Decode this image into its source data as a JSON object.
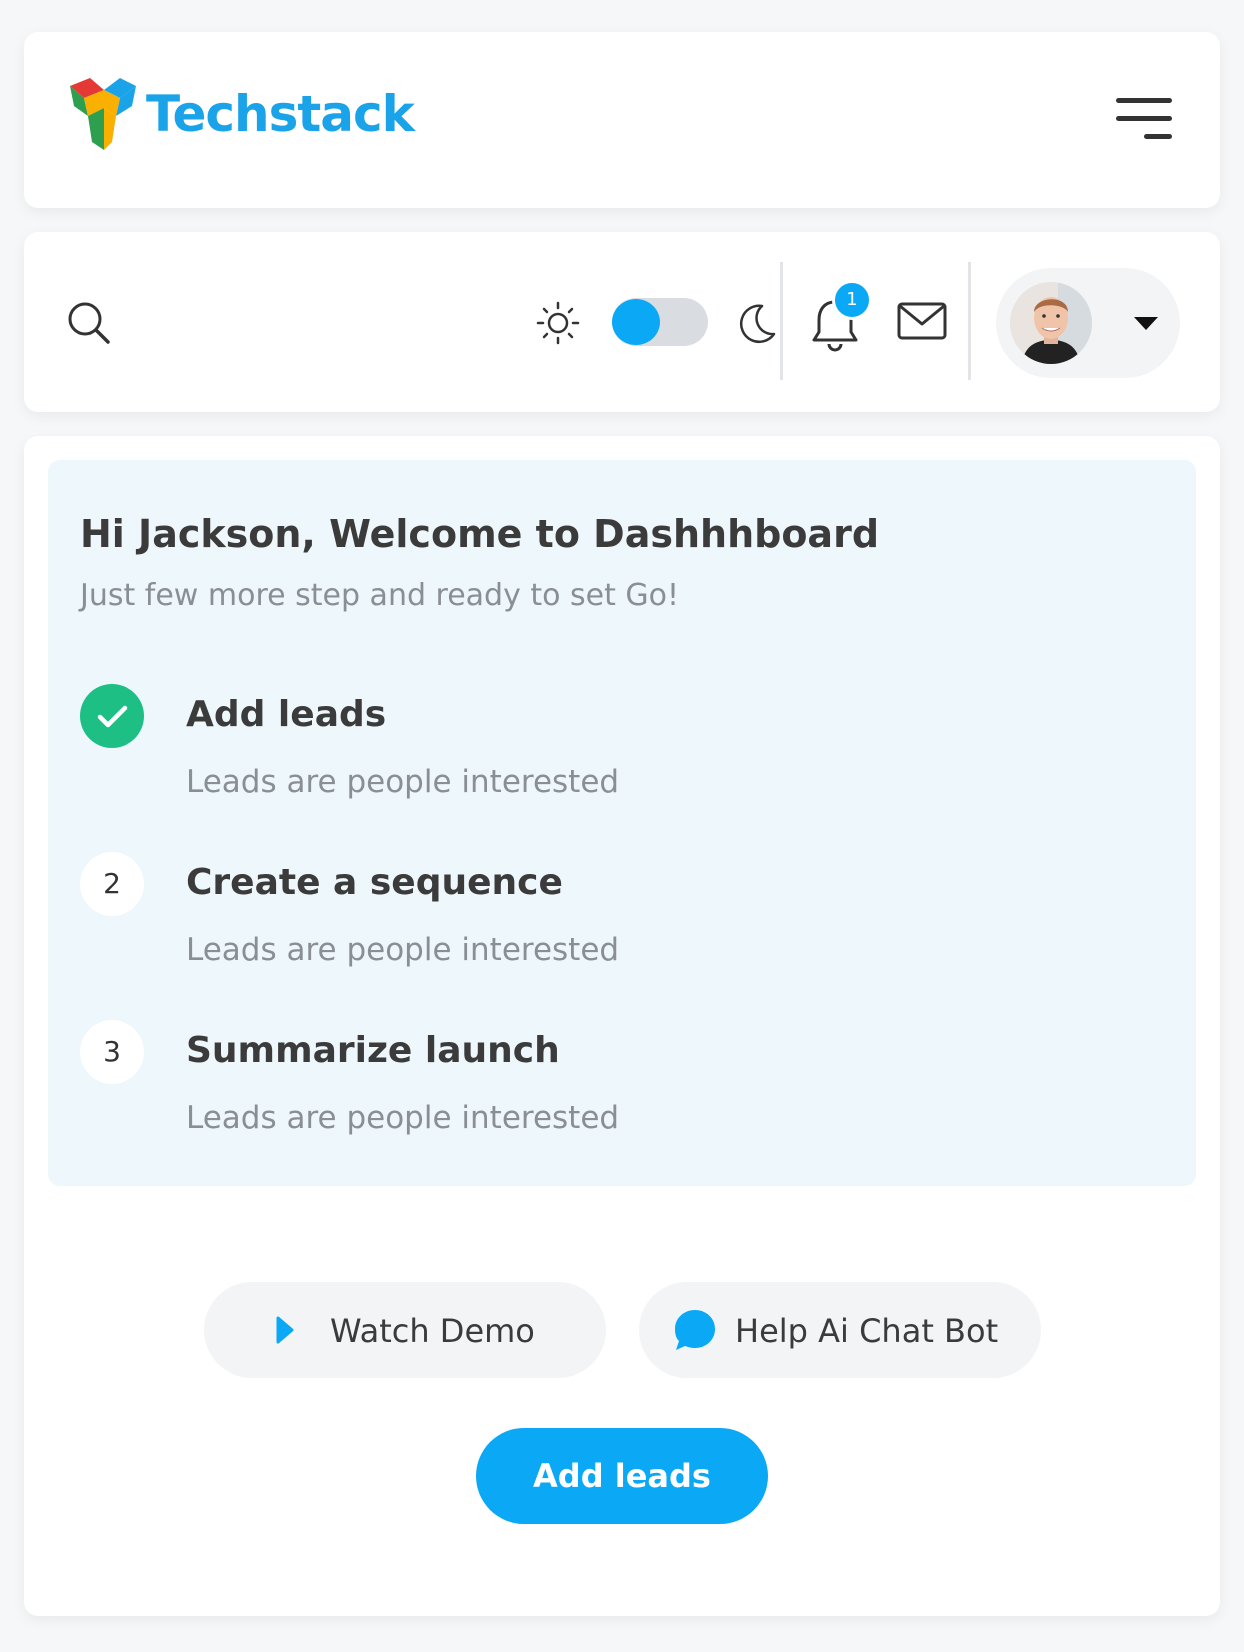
{
  "brand": {
    "name": "Techstack",
    "color": "#1aa3e8"
  },
  "header": {
    "menu_icon": "hamburger-menu-icon"
  },
  "toolbar": {
    "search_icon": "search-icon",
    "theme_toggle": {
      "light_icon": "sun-icon",
      "dark_icon": "moon-icon",
      "state": "light"
    },
    "notifications": {
      "icon": "bell-icon",
      "count": "1"
    },
    "mail_icon": "mail-icon",
    "profile": {
      "avatar": "avatar",
      "dropdown_icon": "caret-down-icon"
    }
  },
  "welcome": {
    "title": "Hi Jackson, Welcome to Dashhhboard",
    "subtitle": "Just few more step and ready to set Go!",
    "steps": [
      {
        "marker": "",
        "status": "done",
        "title": "Add leads",
        "description": "Leads are people interested"
      },
      {
        "marker": "2",
        "status": "pending",
        "title": "Create a sequence",
        "description": "Leads are people interested"
      },
      {
        "marker": "3",
        "status": "pending",
        "title": "Summarize launch",
        "description": "Leads are people interested"
      }
    ]
  },
  "actions": {
    "watch_demo": "Watch Demo",
    "chat_bot": "Help Ai Chat Bot",
    "add_leads": "Add leads"
  },
  "colors": {
    "accent": "#0aa8f5",
    "success": "#1dbf85",
    "panel_bg": "#eef7fc"
  }
}
